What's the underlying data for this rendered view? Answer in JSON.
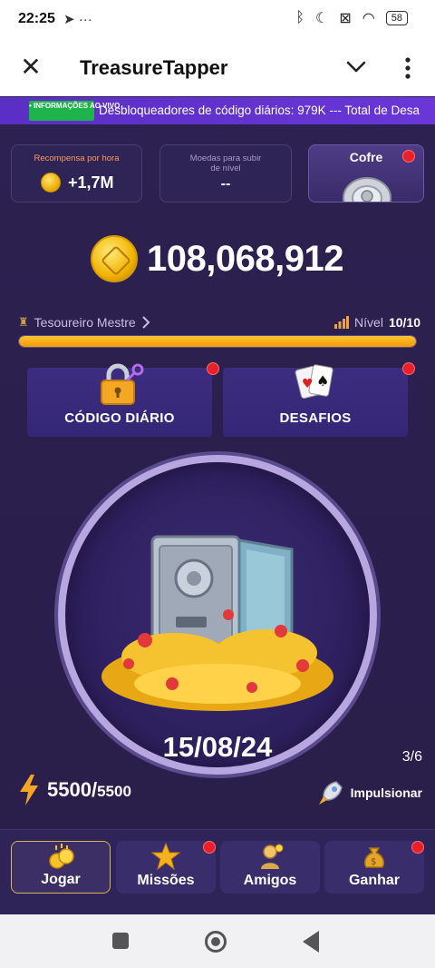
{
  "status_bar": {
    "time": "22:25",
    "battery": "58",
    "left_icons": [
      "telegram-icon",
      "more-dots-icon"
    ],
    "right_icons": [
      "bluetooth-icon",
      "moon-icon",
      "battery-saver-icon",
      "wifi-icon",
      "battery-icon"
    ]
  },
  "app_bar": {
    "title": "TreasureTapper"
  },
  "ticker": {
    "live_badge": "• INFORMAÇÕES AO VIVO",
    "text": "Desbloqueadores de código diários:  979K --- Total de Desa"
  },
  "stats": {
    "reward": {
      "label": "Recompensa por hora",
      "value": "+1,7M"
    },
    "level_coins": {
      "label": "Moedas para subir de nível",
      "value": "--"
    },
    "vault": {
      "label": "Cofre"
    }
  },
  "balance": "108,068,912",
  "rank": {
    "name": "Tesoureiro Mestre",
    "level_label": "Nível",
    "level_value": "10/10",
    "progress": 1.0
  },
  "cards": {
    "daily": "CÓDIGO DIÁRIO",
    "challenges": "DESAFIOS"
  },
  "tapper": {
    "date": "15/08/24",
    "page": "3/6"
  },
  "energy": {
    "current": "5500",
    "separator": "/",
    "max": "5500"
  },
  "boost": "Impulsionar",
  "nav": [
    {
      "label": "Jogar",
      "active": true
    },
    {
      "label": "Missões",
      "badge": true
    },
    {
      "label": "Amigos"
    },
    {
      "label": "Ganhar",
      "badge": true
    }
  ],
  "colors": {
    "accent": "#6a36d8",
    "background": "#2a1f4e",
    "progress": "#f5a800",
    "badge": "#e8202a",
    "live": "#1fb34c"
  }
}
